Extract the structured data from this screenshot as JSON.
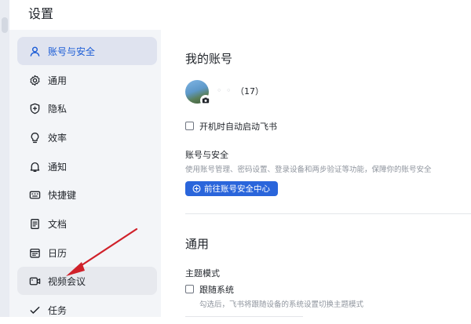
{
  "window": {
    "title": "设置"
  },
  "sidebar": {
    "items": [
      {
        "label": "账号与安全",
        "icon": "user-icon",
        "active": true
      },
      {
        "label": "通用",
        "icon": "gear-icon"
      },
      {
        "label": "隐私",
        "icon": "shield-icon"
      },
      {
        "label": "效率",
        "icon": "lightbulb-icon"
      },
      {
        "label": "通知",
        "icon": "bell-icon"
      },
      {
        "label": "快捷键",
        "icon": "keyboard-icon"
      },
      {
        "label": "文档",
        "icon": "document-icon"
      },
      {
        "label": "日历",
        "icon": "calendar-icon"
      },
      {
        "label": "视频会议",
        "icon": "video-icon",
        "hovered": true
      },
      {
        "label": "任务",
        "icon": "task-check-icon"
      }
    ]
  },
  "account": {
    "heading": "我的账号",
    "count": "（17）",
    "auto_start_label": "开机时自动启动飞书",
    "security_title": "账号与安全",
    "security_desc": "使用账号管理、密码设置、登录设备和两步验证等功能，保障你的账号安全",
    "security_button": "前往账号安全中心"
  },
  "general": {
    "heading": "通用",
    "theme_title": "主题模式",
    "follow_system_label": "跟随系统",
    "follow_system_desc": "勾选后，飞书将跟随设备的系统设置切换主题模式"
  },
  "colors": {
    "accent": "#2a65db",
    "active_bg": "#dfe3ef",
    "sidebar_bg": "#f3f5f8",
    "annotation_arrow": "#d0212a"
  }
}
